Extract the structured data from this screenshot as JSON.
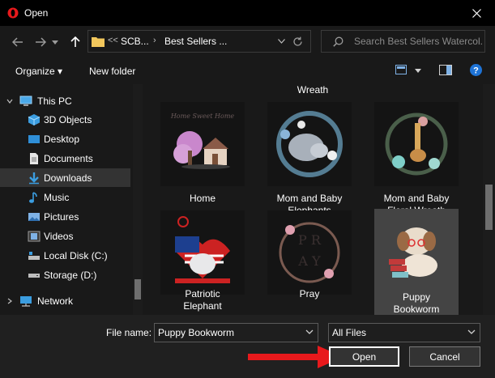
{
  "window": {
    "title": "Open",
    "close_icon": "close-icon"
  },
  "nav": {
    "breadcrumb": {
      "overflow": "<<",
      "items": [
        "SCB...",
        "Best Sellers ..."
      ]
    },
    "search": {
      "placeholder": "Search Best Sellers Watercol..."
    }
  },
  "toolbar": {
    "organize_label": "Organize ▾",
    "new_folder_label": "New folder"
  },
  "sidebar": {
    "items": [
      {
        "label": "This PC",
        "icon": "computer-icon"
      },
      {
        "label": "3D Objects",
        "icon": "3d-objects-icon"
      },
      {
        "label": "Desktop",
        "icon": "desktop-icon"
      },
      {
        "label": "Documents",
        "icon": "documents-icon"
      },
      {
        "label": "Downloads",
        "icon": "downloads-icon",
        "selected": true
      },
      {
        "label": "Music",
        "icon": "music-icon"
      },
      {
        "label": "Pictures",
        "icon": "pictures-icon"
      },
      {
        "label": "Videos",
        "icon": "videos-icon"
      },
      {
        "label": "Local Disk (C:)",
        "icon": "local-disk-icon"
      },
      {
        "label": "Storage (D:)",
        "icon": "storage-drive-icon"
      },
      {
        "label": "Network",
        "icon": "network-icon"
      }
    ]
  },
  "files": {
    "partial_caption": "Wreath",
    "tiles": [
      {
        "caption_line1": "Home",
        "caption_line2": ""
      },
      {
        "caption_line1": "Mom and Baby",
        "caption_line2": "Elephants"
      },
      {
        "caption_line1": "Mom and Baby",
        "caption_line2": "Floral Wreath"
      },
      {
        "caption_line1": "Patriotic",
        "caption_line2": "Elephant"
      },
      {
        "caption_line1": "Pray",
        "caption_line2": ""
      },
      {
        "caption_line1": "Puppy",
        "caption_line2": "Bookworm",
        "selected": true
      }
    ]
  },
  "footer": {
    "file_name_label": "File name:",
    "file_name_value": "Puppy Bookworm",
    "file_type_value": "All Files",
    "open_label": "Open",
    "cancel_label": "Cancel"
  },
  "colors": {
    "accent": "#e8191c",
    "help": "#1e73d6",
    "folder": "#f2c75c"
  }
}
